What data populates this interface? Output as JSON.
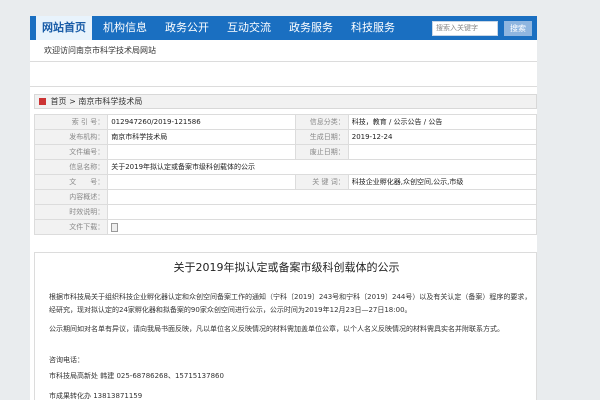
{
  "nav": {
    "tabs": [
      "网站首页",
      "机构信息",
      "政务公开",
      "互动交流",
      "政务服务",
      "科技服务"
    ],
    "search_placeholder": "搜索入关键字",
    "search_button": "搜索"
  },
  "welcome": "欢迎访问南京市科学技术局网站",
  "breadcrumb": {
    "home": "首页",
    "separator": " > ",
    "current": "南京市科学技术局"
  },
  "info": {
    "index_label": "索 引 号：",
    "index_value": "012947260/2019-121586",
    "category_label": "信息分类：",
    "category_value": "科技，教育 / 公示公告 / 公告",
    "publisher_label": "发布机构：",
    "publisher_value": "南京市科学技术局",
    "date_label": "生成日期：",
    "date_value": "2019-12-24",
    "docno_label": "文件编号：",
    "docno_value": "",
    "expire_label": "废止日期：",
    "expire_value": "",
    "name_label": "信息名称：",
    "name_value": "关于2019年拟认定或备案市级科创载体的公示",
    "text_label": "文　　号：",
    "text_value": "",
    "keywords_label": "关 键 词：",
    "keywords_value": "科技企业孵化器,众创空间,公示,市级",
    "summary_label": "内容概述：",
    "summary_value": "",
    "validity_label": "时效说明：",
    "validity_value": "",
    "download_label": "文件下载：",
    "download_value": ""
  },
  "article": {
    "title": "关于2019年拟认定或备案市级科创载体的公示",
    "para1": "根据市科技局关于组织科技企业孵化器认定和众创空间备案工作的通知（宁科〔2019〕243号和宁科〔2019〕244号）以及有关认定（备案）程序的要求，经研究，现对拟认定的24家孵化器和拟备案的90家众创空间进行公示，公示时间为2019年12月23日—27日18:00。",
    "para2": "公示期间如对名单有异议，请向我局书面反映，凡以单位名义反映情况的材料需加盖单位公章，以个人名义反映情况的材料需具实名并附联系方式。",
    "contact_label": "咨询电话：",
    "contact_line": "市科技局高新处  韩建  025-68786268、15715137860",
    "contact_line2": "市成果转化办  13813871159"
  }
}
